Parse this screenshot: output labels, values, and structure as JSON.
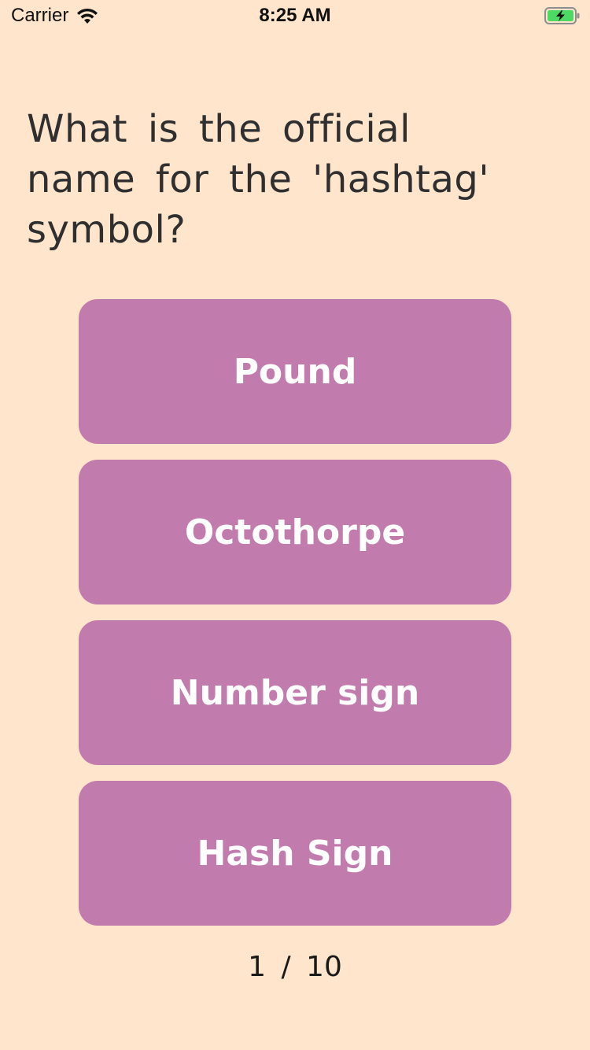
{
  "status_bar": {
    "carrier": "Carrier",
    "time": "8:25 AM",
    "wifi_icon": "wifi-icon",
    "battery_icon": "battery-charging-icon",
    "battery_color": "#4CD964"
  },
  "question": {
    "text": "What is the official name for the 'hashtag' symbol?"
  },
  "answers": [
    {
      "label": "Pound"
    },
    {
      "label": "Octothorpe"
    },
    {
      "label": "Number sign"
    },
    {
      "label": "Hash Sign"
    }
  ],
  "progress": {
    "text": "1 / 10"
  },
  "colors": {
    "background": "#FFE5CC",
    "button": "#C27BAD",
    "button_text": "#FFFFFF"
  }
}
